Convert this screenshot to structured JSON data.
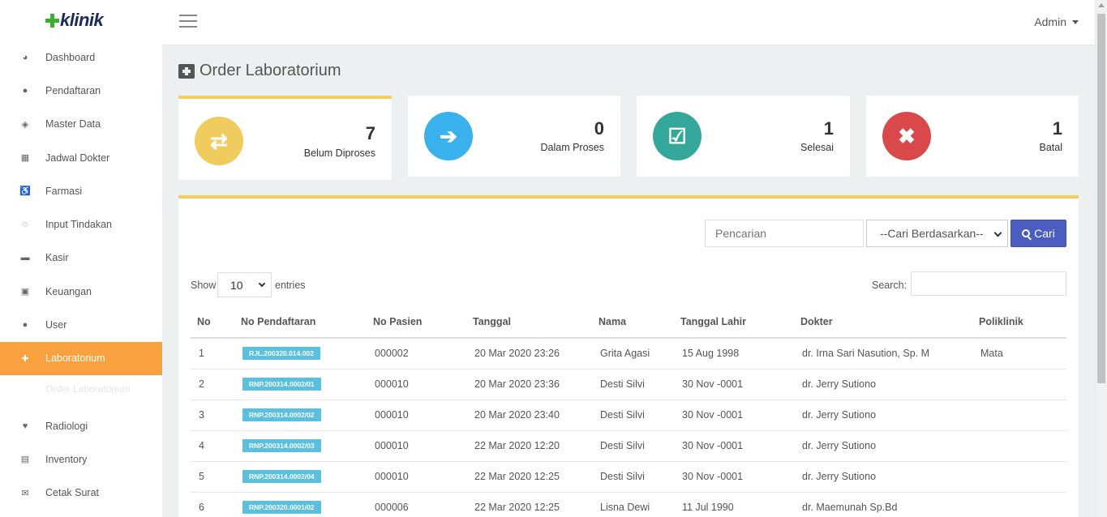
{
  "app": {
    "logo_text": "klinik"
  },
  "header": {
    "user_label": "Admin"
  },
  "sidebar": {
    "items": [
      {
        "label": "Dashboard",
        "icon": "dashboard-icon",
        "glyph": "◕"
      },
      {
        "label": "Pendaftaran",
        "icon": "user-icon",
        "glyph": "●"
      },
      {
        "label": "Master Data",
        "icon": "cube-icon",
        "glyph": "◈"
      },
      {
        "label": "Jadwal Dokter",
        "icon": "calendar-icon",
        "glyph": "▦"
      },
      {
        "label": "Farmasi",
        "icon": "wheelchair-icon",
        "glyph": "♿"
      },
      {
        "label": "Input Tindakan",
        "icon": "rss-icon",
        "glyph": "◌"
      },
      {
        "label": "Kasir",
        "icon": "cart-icon",
        "glyph": "▬"
      },
      {
        "label": "Keuangan",
        "icon": "money-icon",
        "glyph": "▣"
      },
      {
        "label": "User",
        "icon": "users-icon",
        "glyph": "●"
      },
      {
        "label": "Laboratorium",
        "icon": "medkit-icon",
        "glyph": "✚"
      }
    ],
    "active_submenu": "Order Laboratorium",
    "items_after": [
      {
        "label": "Radiologi",
        "icon": "heartbeat-icon",
        "glyph": "♥"
      },
      {
        "label": "Inventory",
        "icon": "file-icon",
        "glyph": "▤"
      },
      {
        "label": "Cetak Surat",
        "icon": "envelope-icon",
        "glyph": "✉"
      }
    ]
  },
  "page": {
    "title": "Order Laboratorium"
  },
  "stats": [
    {
      "value": "7",
      "label": "Belum Diproses",
      "color": "#f0cc5e",
      "icon": "exchange-icon"
    },
    {
      "value": "0",
      "label": "Dalam Proses",
      "color": "#39b1ec",
      "icon": "sign-in-icon"
    },
    {
      "value": "1",
      "label": "Selesai",
      "color": "#35a79a",
      "icon": "check-square-icon"
    },
    {
      "value": "1",
      "label": "Batal",
      "color": "#d9494b",
      "icon": "times-icon"
    }
  ],
  "search": {
    "placeholder": "Pencarian",
    "select_value": "--Cari Berdasarkan--",
    "button_label": "Cari"
  },
  "datatable": {
    "show_label": "Show",
    "page_length": "10",
    "entries_label": "entries",
    "search_label": "Search:"
  },
  "table": {
    "columns": [
      "No",
      "No Pendaftaran",
      "No Pasien",
      "Tanggal",
      "Nama",
      "Tanggal Lahir",
      "Dokter",
      "Poliklinik"
    ],
    "rows": [
      {
        "no": "1",
        "reg": "RJL.200320.014.002",
        "pasien": "000002",
        "tanggal": "20 Mar 2020 23:26",
        "nama": "Grita Agasi",
        "lahir": "15 Aug 1998",
        "dokter": "dr. Irna Sari Nasution, Sp. M",
        "poli": "Mata"
      },
      {
        "no": "2",
        "reg": "RNP.200314.0002/01",
        "pasien": "000010",
        "tanggal": "20 Mar 2020 23:36",
        "nama": "Desti Silvi",
        "lahir": "30 Nov -0001",
        "dokter": "dr. Jerry Sutiono",
        "poli": ""
      },
      {
        "no": "3",
        "reg": "RNP.200314.0002/02",
        "pasien": "000010",
        "tanggal": "20 Mar 2020 23:40",
        "nama": "Desti Silvi",
        "lahir": "30 Nov -0001",
        "dokter": "dr. Jerry Sutiono",
        "poli": ""
      },
      {
        "no": "4",
        "reg": "RNP.200314.0002/03",
        "pasien": "000010",
        "tanggal": "22 Mar 2020 12:20",
        "nama": "Desti Silvi",
        "lahir": "30 Nov -0001",
        "dokter": "dr. Jerry Sutiono",
        "poli": ""
      },
      {
        "no": "5",
        "reg": "RNP.200314.0002/04",
        "pasien": "000010",
        "tanggal": "22 Mar 2020 12:25",
        "nama": "Desti Silvi",
        "lahir": "30 Nov -0001",
        "dokter": "dr. Jerry Sutiono",
        "poli": ""
      },
      {
        "no": "6",
        "reg": "RNP.200320.0001/02",
        "pasien": "000006",
        "tanggal": "22 Mar 2020 12:25",
        "nama": "Lisna Dewi",
        "lahir": "11 Jul 1990",
        "dokter": "dr. Maemunah Sp.Bd",
        "poli": ""
      }
    ]
  }
}
